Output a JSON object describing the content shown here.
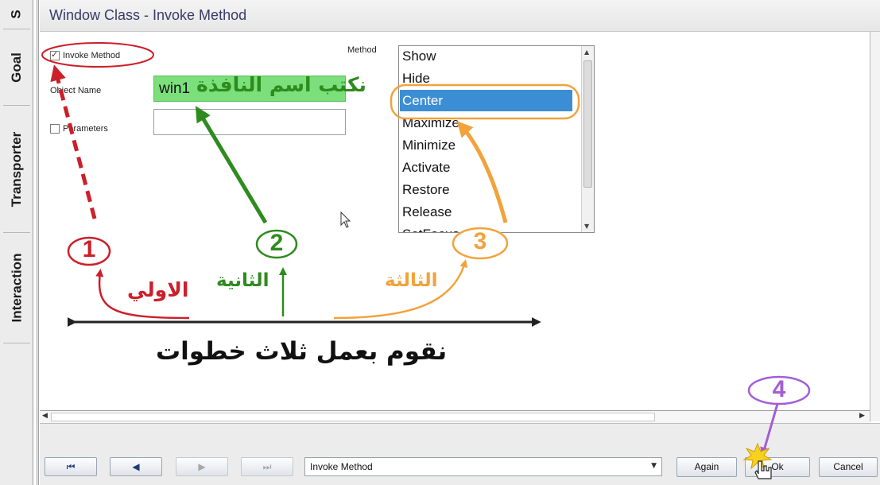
{
  "window": {
    "title": "Window Class - Invoke Method"
  },
  "side_tabs": [
    {
      "label": "S"
    },
    {
      "label": "Goal"
    },
    {
      "label": "Transporter"
    },
    {
      "label": "Interaction"
    }
  ],
  "form": {
    "invoke_method_label": "Invoke Method",
    "invoke_method_checked": true,
    "method_label": "Method",
    "object_name_label": "Object Name",
    "object_name_value": "win1",
    "parameters_label": "Parameters",
    "parameters_checked": false,
    "parameters_value": ""
  },
  "method_list": {
    "items": [
      "Show",
      "Hide",
      "Center",
      "Maximize",
      "Minimize",
      "Activate",
      "Restore",
      "Release",
      "SetFocus"
    ],
    "selected": "Center"
  },
  "toolbar": {
    "first_icon": "first-page-icon",
    "prev_icon": "previous-icon",
    "next_icon": "next-icon",
    "last_icon": "last-page-icon",
    "combo_value": "Invoke Method",
    "again_label": "Again",
    "ok_label": "Ok",
    "cancel_label": "Cancel"
  },
  "annotations": {
    "caption_object_name": "نكتب اسم النافذة",
    "step1_number": "1",
    "step2_number": "2",
    "step3_number": "3",
    "step4_number": "4",
    "step1_word": "الاولي",
    "step2_word": "الثانية",
    "step3_word": "الثالثة",
    "summary": "نقوم بعمل ثلاث خطوات",
    "colors": {
      "step1": "#cc1f2a",
      "step2": "#2e8b1e",
      "step3": "#f2a23a",
      "step4": "#a25ed6",
      "summary": "#111111"
    }
  }
}
